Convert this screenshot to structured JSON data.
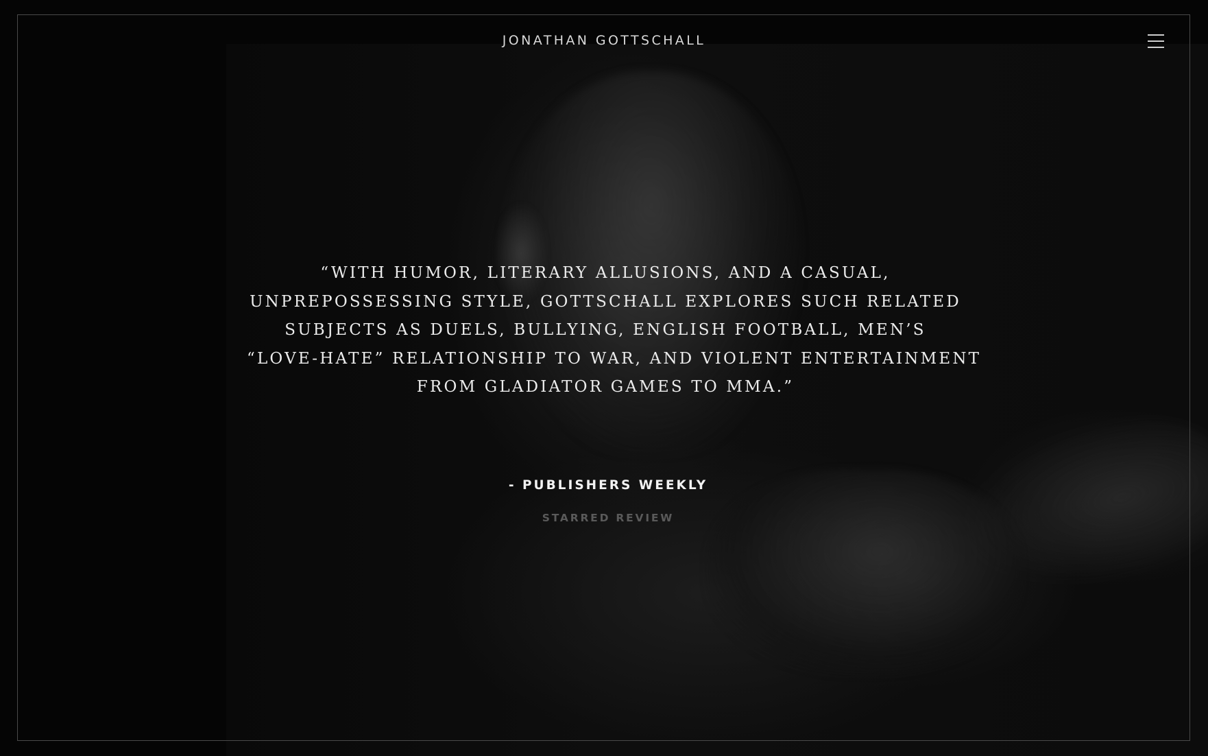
{
  "header": {
    "title": "JONATHAN GOTTSCHALL",
    "menu_icon": "hamburger-menu-icon"
  },
  "quote": {
    "lines": [
      "“WITH HUMOR, LITERARY ALLUSIONS, AND A CASUAL,",
      "UNPREPOSSESSING STYLE, GOTTSCHALL EXPLORES SUCH RELATED",
      "SUBJECTS AS DUELS, BULLYING, ENGLISH FOOTBALL, MEN’S",
      "“LOVE-HATE” RELATIONSHIP TO WAR, AND VIOLENT ENTERTAINMENT",
      "FROM GLADIATOR GAMES TO MMA.”"
    ],
    "attribution": "- PUBLISHERS WEEKLY",
    "subtitle": "STARRED REVIEW"
  },
  "colors": {
    "background": "#050505",
    "frame": "#4a4a4a",
    "quote_text": "#ececec",
    "subtitle_text": "#5a5a5a"
  }
}
